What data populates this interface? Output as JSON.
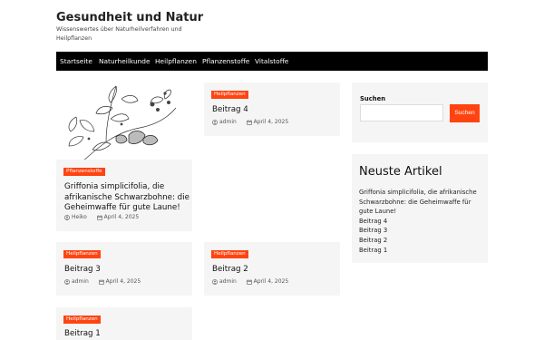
{
  "site": {
    "title": "Gesundheit und Natur",
    "description": "Wissenswertes über Naturheilverfahren und Heilpflanzen"
  },
  "nav": {
    "items": [
      {
        "label": "Startseite"
      },
      {
        "label": "Naturheilkunde"
      },
      {
        "label": "Heilpflanzen"
      },
      {
        "label": "Pflanzenstoffe"
      },
      {
        "label": "Vitalstoffe"
      }
    ]
  },
  "posts": [
    {
      "category": "Pflanzenstoffe",
      "title": "Griffonia simplicifolia, die afrikanische Schwarzbohne: die Geheimwaffe für gute Laune!",
      "author": "Heiko",
      "date": "April 4, 2025"
    },
    {
      "category": "Heilpflanzen",
      "title": "Beitrag 4",
      "author": "admin",
      "date": "April 4, 2025"
    },
    {
      "category": "Heilpflanzen",
      "title": "Beitrag 3",
      "author": "admin",
      "date": "April 4, 2025"
    },
    {
      "category": "Heilpflanzen",
      "title": "Beitrag 2",
      "author": "admin",
      "date": "April 4, 2025"
    },
    {
      "category": "Heilpflanzen",
      "title": "Beitrag 1"
    }
  ],
  "sidebar": {
    "search": {
      "label": "Suchen",
      "button": "Suchen",
      "placeholder": ""
    },
    "recent": {
      "title": "Neuste Artikel",
      "items": [
        "Griffonia simplicifolia, die afrikanische Schwarzbohne: die Geheimwaffe für gute Laune!",
        "Beitrag 4",
        "Beitrag 3",
        "Beitrag 2",
        "Beitrag 1"
      ]
    }
  },
  "colors": {
    "accent": "#ff4411",
    "nav_bg": "#000000",
    "card_bg": "#f5f5f5"
  }
}
